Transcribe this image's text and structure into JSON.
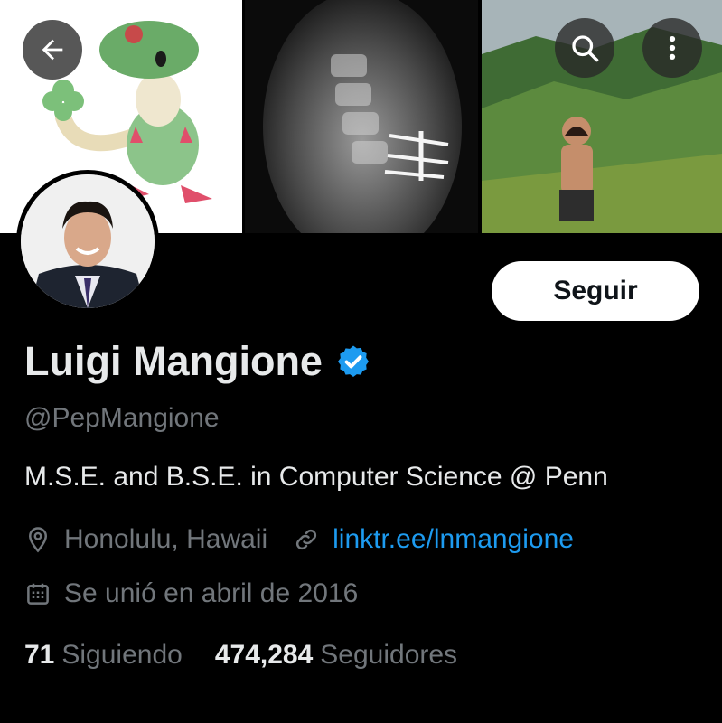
{
  "header": {
    "back_icon": "arrow-left-icon",
    "search_icon": "search-icon",
    "more_icon": "more-vertical-icon"
  },
  "profile": {
    "name": "Luigi Mangione",
    "verified_icon": "verified-badge-icon",
    "handle": "@PepMangione",
    "bio": "M.S.E. and B.S.E. in Computer Science @ Penn",
    "location": "Honolulu, Hawaii",
    "link": "linktr.ee/lnmangione",
    "joined": "Se unió en abril de 2016",
    "follow_label": "Seguir"
  },
  "stats": {
    "following_count": "71",
    "following_label": "Siguiendo",
    "followers_count": "474,284",
    "followers_label": "Seguidores"
  },
  "colors": {
    "background": "#000000",
    "primary_text": "#e7e9ea",
    "secondary_text": "#71767b",
    "link": "#1d9bf0",
    "verified": "#1d9bf0"
  }
}
